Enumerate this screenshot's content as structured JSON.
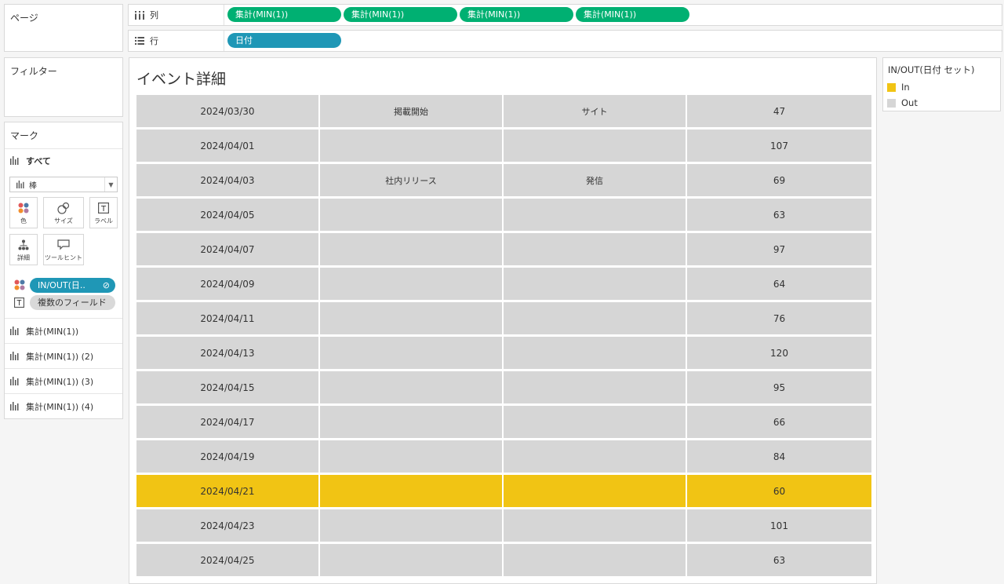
{
  "pages_label": "ページ",
  "filters_label": "フィルター",
  "shelves": {
    "columns_label": "列",
    "rows_label": "行",
    "columns_pills": [
      "集計(MIN(1))",
      "集計(MIN(1))",
      "集計(MIN(1))",
      "集計(MIN(1))"
    ],
    "rows_pills": [
      "日付"
    ]
  },
  "marks": {
    "title": "マーク",
    "all_label": "すべて",
    "mark_type": "棒",
    "buttons": {
      "color": "色",
      "size": "サイズ",
      "label": "ラベル",
      "detail": "詳細",
      "tooltip": "ツールヒント"
    },
    "encodings": {
      "color_field": "IN/OUT(日..",
      "text_field": "複数のフィールド"
    },
    "measures": [
      "集計(MIN(1))",
      "集計(MIN(1)) (2)",
      "集計(MIN(1)) (3)",
      "集計(MIN(1)) (4)"
    ]
  },
  "sheet": {
    "title": "イベント詳細",
    "rows": [
      {
        "date": "2024/03/30",
        "event": "掲載開始",
        "channel": "サイト",
        "value": "47",
        "set": "Out"
      },
      {
        "date": "2024/04/01",
        "event": "",
        "channel": "",
        "value": "107",
        "set": "Out"
      },
      {
        "date": "2024/04/03",
        "event": "社内リリース",
        "channel": "発信",
        "value": "69",
        "set": "Out"
      },
      {
        "date": "2024/04/05",
        "event": "",
        "channel": "",
        "value": "63",
        "set": "Out"
      },
      {
        "date": "2024/04/07",
        "event": "",
        "channel": "",
        "value": "97",
        "set": "Out"
      },
      {
        "date": "2024/04/09",
        "event": "",
        "channel": "",
        "value": "64",
        "set": "Out"
      },
      {
        "date": "2024/04/11",
        "event": "",
        "channel": "",
        "value": "76",
        "set": "Out"
      },
      {
        "date": "2024/04/13",
        "event": "",
        "channel": "",
        "value": "120",
        "set": "Out"
      },
      {
        "date": "2024/04/15",
        "event": "",
        "channel": "",
        "value": "95",
        "set": "Out"
      },
      {
        "date": "2024/04/17",
        "event": "",
        "channel": "",
        "value": "66",
        "set": "Out"
      },
      {
        "date": "2024/04/19",
        "event": "",
        "channel": "",
        "value": "84",
        "set": "Out"
      },
      {
        "date": "2024/04/21",
        "event": "",
        "channel": "",
        "value": "60",
        "set": "In"
      },
      {
        "date": "2024/04/23",
        "event": "",
        "channel": "",
        "value": "101",
        "set": "Out"
      },
      {
        "date": "2024/04/25",
        "event": "",
        "channel": "",
        "value": "63",
        "set": "Out"
      }
    ]
  },
  "legend": {
    "title": "IN/OUT(日付 セット)",
    "items": [
      {
        "label": "In",
        "color": "#f1c414"
      },
      {
        "label": "Out",
        "color": "#d6d6d6"
      }
    ]
  },
  "colors": {
    "pill_green": "#00b072",
    "pill_blue": "#1f97b6",
    "in_highlight": "#f1c414",
    "out_grey": "#d6d6d6"
  }
}
